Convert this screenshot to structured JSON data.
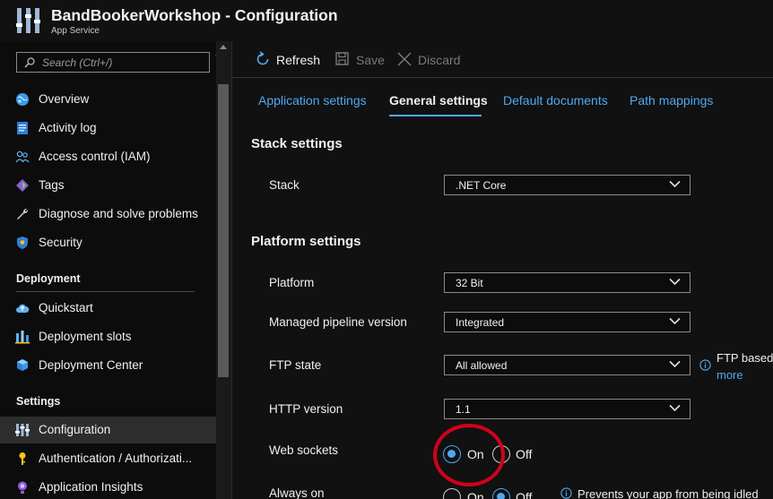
{
  "header": {
    "title": "BandBookerWorkshop - Configuration",
    "subtitle": "App Service"
  },
  "sidebar": {
    "search_placeholder": "Search (Ctrl+/)",
    "collapse_glyph": "«",
    "top_items": [
      {
        "label": "Overview",
        "icon": "globe-icon"
      },
      {
        "label": "Activity log",
        "icon": "log-icon"
      },
      {
        "label": "Access control (IAM)",
        "icon": "people-icon"
      },
      {
        "label": "Tags",
        "icon": "tag-icon"
      },
      {
        "label": "Diagnose and solve problems",
        "icon": "wrench-icon"
      },
      {
        "label": "Security",
        "icon": "shield-icon"
      }
    ],
    "deployment_title": "Deployment",
    "deployment_items": [
      {
        "label": "Quickstart",
        "icon": "cloud-icon"
      },
      {
        "label": "Deployment slots",
        "icon": "slots-icon"
      },
      {
        "label": "Deployment Center",
        "icon": "cube-icon"
      }
    ],
    "settings_title": "Settings",
    "settings_items": [
      {
        "label": "Configuration",
        "icon": "config-icon",
        "active": true
      },
      {
        "label": "Authentication / Authorizati...",
        "icon": "key-icon"
      },
      {
        "label": "Application Insights",
        "icon": "bulb-icon"
      }
    ]
  },
  "toolbar": {
    "refresh": "Refresh",
    "save": "Save",
    "discard": "Discard"
  },
  "tabs": [
    {
      "label": "Application settings"
    },
    {
      "label": "General settings",
      "active": true
    },
    {
      "label": "Default documents"
    },
    {
      "label": "Path mappings"
    }
  ],
  "stack_settings": {
    "title": "Stack settings",
    "stack_label": "Stack",
    "stack_value": ".NET Core"
  },
  "platform_settings": {
    "title": "Platform settings",
    "platform_label": "Platform",
    "platform_value": "32 Bit",
    "pipeline_label": "Managed pipeline version",
    "pipeline_value": "Integrated",
    "ftp_label": "FTP state",
    "ftp_value": "All allowed",
    "ftp_info": "FTP based",
    "ftp_more": "more",
    "http_label": "HTTP version",
    "http_value": "1.1",
    "websockets_label": "Web sockets",
    "websockets_on": "On",
    "websockets_off": "Off",
    "websockets_selected": "On",
    "alwayson_label": "Always on",
    "alwayson_on": "On",
    "alwayson_off": "Off",
    "alwayson_selected": "Off",
    "alwayson_info": "Prevents your app from being idled"
  },
  "colors": {
    "accent": "#4fa9f0",
    "annotation": "#d0021b",
    "active_nav": "#2d2d2d"
  }
}
